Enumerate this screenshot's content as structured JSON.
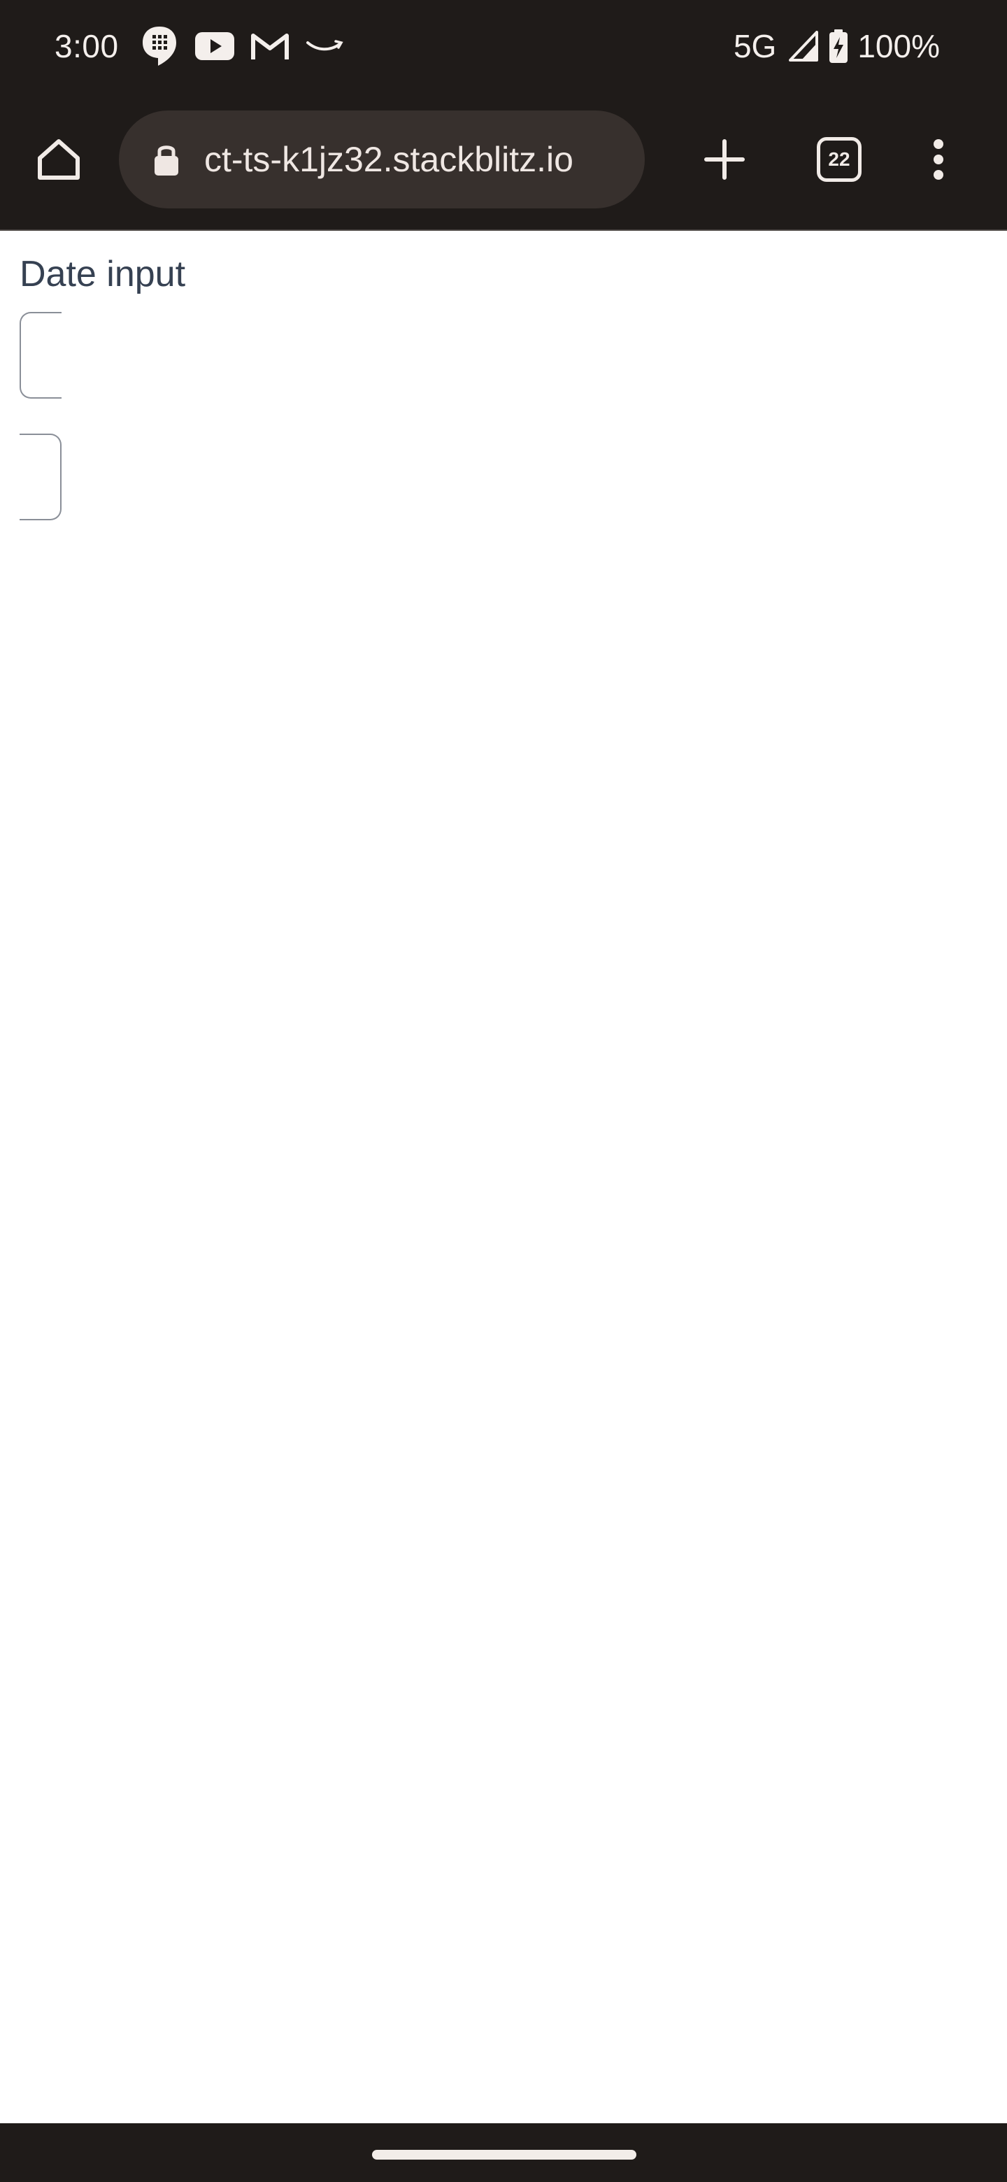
{
  "status_bar": {
    "time": "3:00",
    "network": "5G",
    "battery": "100%",
    "icons": [
      "chat-icon",
      "youtube-icon",
      "gmail-icon",
      "amazon-icon",
      "signal-icon",
      "battery-charging-icon"
    ]
  },
  "browser": {
    "url": "ct-ts-k1jz32.stackblitz.io",
    "tab_count": "22"
  },
  "page": {
    "label": "Date input"
  },
  "colors": {
    "chrome_dark": "#1f1b19",
    "omnibox": "#37302d",
    "label_text": "#364152",
    "input_border": "#8a8f98"
  }
}
